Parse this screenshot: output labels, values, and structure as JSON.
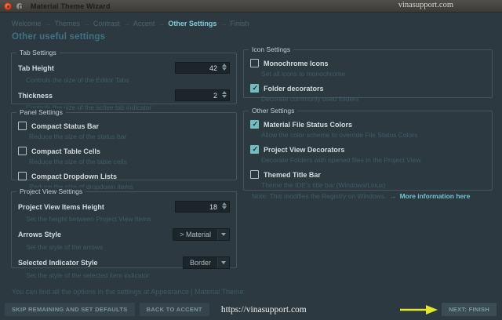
{
  "titlebar": {
    "title": "Material Theme Wizard",
    "watermark": "vinasupport.com"
  },
  "breadcrumb": {
    "sep": "→",
    "items": [
      "Welcome",
      "Themes",
      "Contrast",
      "Accent",
      "Other Settings",
      "Finish"
    ],
    "active": "Other Settings"
  },
  "page": {
    "heading": "Other useful settings",
    "footer_note": "You can find all the options in the settings at Appearance | Material Theme"
  },
  "groups": {
    "tab_settings": {
      "title": "Tab Settings",
      "rows": [
        {
          "label": "Tab Height",
          "desc": "Controls the size of the Editor Tabs",
          "value": "42"
        },
        {
          "label": "Thickness",
          "desc": "Controls the size of the active tab indicator",
          "value": "2"
        }
      ]
    },
    "panel_settings": {
      "title": "Panel Settings",
      "rows": [
        {
          "label": "Compact Status Bar",
          "desc": "Reduce the size of the status bar",
          "checked": false
        },
        {
          "label": "Compact Table Cells",
          "desc": "Reduce the size of the table cells",
          "checked": false
        },
        {
          "label": "Compact Dropdown Lists",
          "desc": "Reduce the size of dropdown items",
          "checked": false
        }
      ]
    },
    "project_view_settings": {
      "title": "Project View Settings",
      "rows": [
        {
          "label": "Project View Items Height",
          "desc": "Set the height between Project View Items",
          "value": "18"
        },
        {
          "label": "Arrows Style",
          "desc": "Set the style of the arrows",
          "value": "> Material"
        },
        {
          "label": "Selected Indicator Style",
          "desc": "Set the style of the selected item indicator",
          "value": "Border"
        }
      ]
    },
    "icon_settings": {
      "title": "Icon Settings",
      "rows": [
        {
          "label": "Monochrome Icons",
          "desc": "Set all icons to monochrome",
          "checked": false
        },
        {
          "label": "Folder decorators",
          "desc": "Decorate commonly used folders",
          "checked": true
        }
      ]
    },
    "other_settings": {
      "title": "Other Settings",
      "rows": [
        {
          "label": "Material File Status Colors",
          "desc": "Allow the color scheme to override File Status Colors",
          "checked": true
        },
        {
          "label": "Project View Decorators",
          "desc": "Decorate Folders with opened files in the Project View",
          "checked": true
        },
        {
          "label": "Themed Title Bar",
          "desc": "Theme the IDE's title bar (Windows/Linux)",
          "checked": false
        }
      ],
      "note": {
        "text": "Note: This modifies the Registry on Windows.",
        "link_arrow": "→",
        "link": "More information here"
      }
    }
  },
  "footer": {
    "skip_button": "SKIP REMAINING AND SET DEFAULTS",
    "back_button": "BACK TO ACCENT",
    "watermark": "https://vinasupport.com",
    "next_button": "NEXT: FINISH"
  },
  "colors": {
    "accent_teal": "#7fccd8",
    "checkbox_checked": "#74bcc0",
    "annotation_arrow": "#e3e62c",
    "window_bg": "#2c3940",
    "titlebar_close": "#df4a1f"
  }
}
